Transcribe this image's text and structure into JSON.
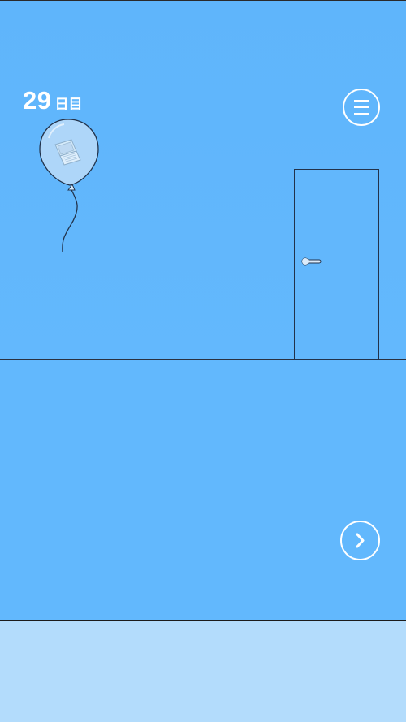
{
  "hud": {
    "day_number": "29",
    "day_unit": "日目"
  },
  "icons": {
    "menu": "hamburger-menu-icon",
    "next": "chevron-right-icon",
    "balloon_item": "laptop-icon"
  },
  "colors": {
    "wall": "#5fb5fb",
    "floor": "#62b8fd",
    "bottom_bar": "#b3dcfc",
    "ui_white": "#ffffff",
    "line": "#22324a"
  }
}
